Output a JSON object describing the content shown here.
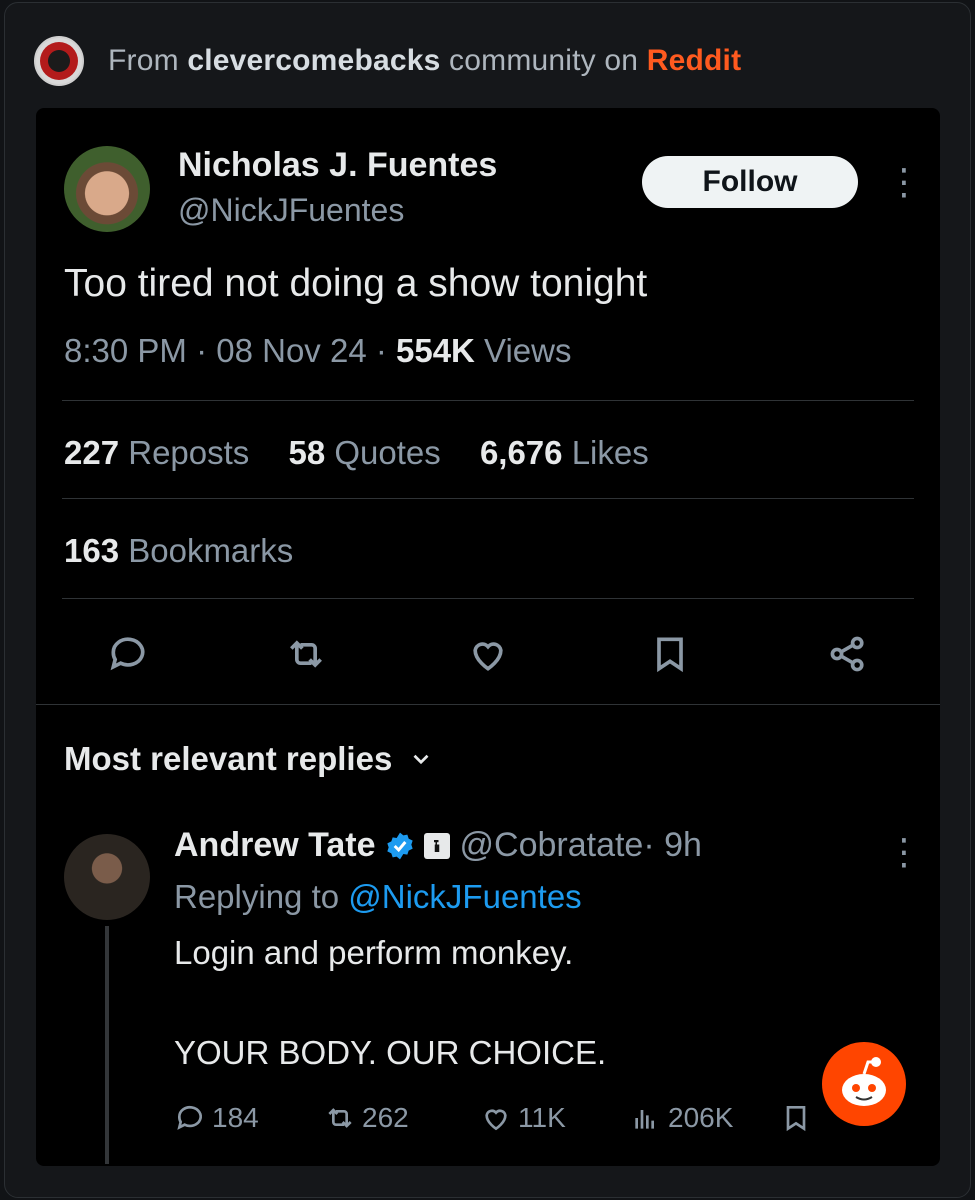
{
  "header": {
    "prefix": "From ",
    "subreddit": "clevercomebacks",
    "middle": " community on ",
    "site": "Reddit"
  },
  "tweet": {
    "name": "Nicholas J. Fuentes",
    "handle": "@NickJFuentes",
    "follow_label": "Follow",
    "text": "Too tired not doing a show tonight",
    "time": "8:30 PM",
    "dot1": " · ",
    "date": "08 Nov 24",
    "dot2": " · ",
    "views_count": "554K",
    "views_label": " Views",
    "reposts_count": "227",
    "reposts_label": " Reposts",
    "quotes_count": "58",
    "quotes_label": " Quotes",
    "likes_count": "6,676",
    "likes_label": " Likes",
    "bookmarks_count": "163",
    "bookmarks_label": " Bookmarks"
  },
  "replies_section": {
    "title": "Most relevant replies"
  },
  "reply": {
    "name": "Andrew Tate",
    "handle": "@Cobratate",
    "time": " · 9h",
    "replying_prefix": "Replying to ",
    "replying_to": "@NickJFuentes",
    "line1": "Login and perform monkey.",
    "line2": "YOUR BODY. OUR CHOICE.",
    "replies": "184",
    "reposts": "262",
    "likes": "11K",
    "views": "206K"
  },
  "colors": {
    "accent_blue": "#1d9bf0",
    "reddit_orange": "#ff5a1f",
    "muted_text": "#8b98a5"
  },
  "icons": [
    "subreddit-avatar-icon",
    "more-icon",
    "reply-icon",
    "repost-icon",
    "like-icon",
    "bookmark-icon",
    "share-icon",
    "chevron-down-icon",
    "verified-badge-icon",
    "views-icon",
    "reddit-snoo-icon"
  ]
}
